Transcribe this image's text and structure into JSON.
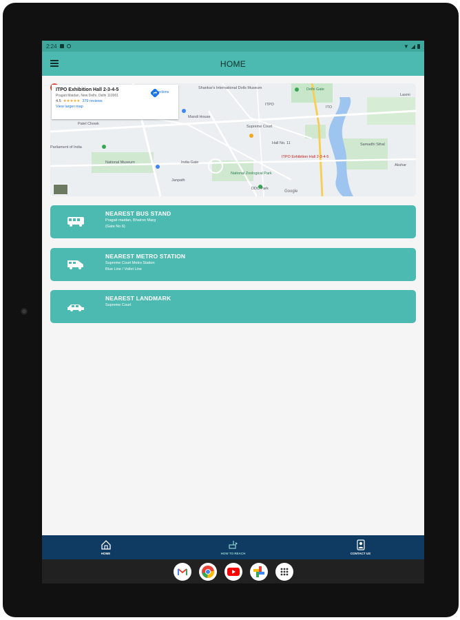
{
  "status_bar": {
    "time": "2:24"
  },
  "app_bar": {
    "title": "HOME"
  },
  "map": {
    "place_title": "ITPO Exhibition Hall 2-3-4-5",
    "address": "Pragati Maidan, New Delhi, Delhi 110001",
    "rating": "4.5",
    "stars": "★★★★★",
    "reviews": "379 reviews",
    "view_larger": "View larger map",
    "directions": "Directions",
    "labels": {
      "shankars": "Shankar's International Dolls Museum",
      "delhi_gate": "Delhi Gate",
      "itpo_label": "ITPO",
      "ito": "ITO",
      "mandi_house": "Mandi House",
      "supreme_court": "Supreme Court",
      "hall_11": "Hall No. 11",
      "pin_label": "ITPO Exhibition Hall 2-3-4-5",
      "patel_chowk": "Patel Chowk",
      "parliament": "Parliament of India",
      "national_museum": "National Museum",
      "india_gate": "India Gate",
      "national_zoo": "National Zoological Park",
      "samadhi": "Samadhi Sthal",
      "akshar": "Akshar",
      "ddc": "DDC Park",
      "laxmi": "Laxmi",
      "janpath": "Janpath"
    },
    "google": "Google"
  },
  "cards": [
    {
      "title": "NEAREST BUS STAND",
      "line1": "Pragati maidan, Bhairon Marg",
      "line2": "(Gate No 6)"
    },
    {
      "title": "NEAREST METRO STATION",
      "line1": "Supreme Court Metro Station",
      "line2": "Blue Line / Voilet Line"
    },
    {
      "title": "NEAREST LANDMARK",
      "line1": "Supreme Court",
      "line2": ""
    }
  ],
  "bottom_nav": {
    "home": "HOME",
    "how_to_reach": "HOW TO REACH",
    "contact_us": "CONTACT US"
  },
  "colors": {
    "teal": "#4cbab0",
    "navy": "#0f3a62",
    "status_teal": "#3fa89d"
  }
}
